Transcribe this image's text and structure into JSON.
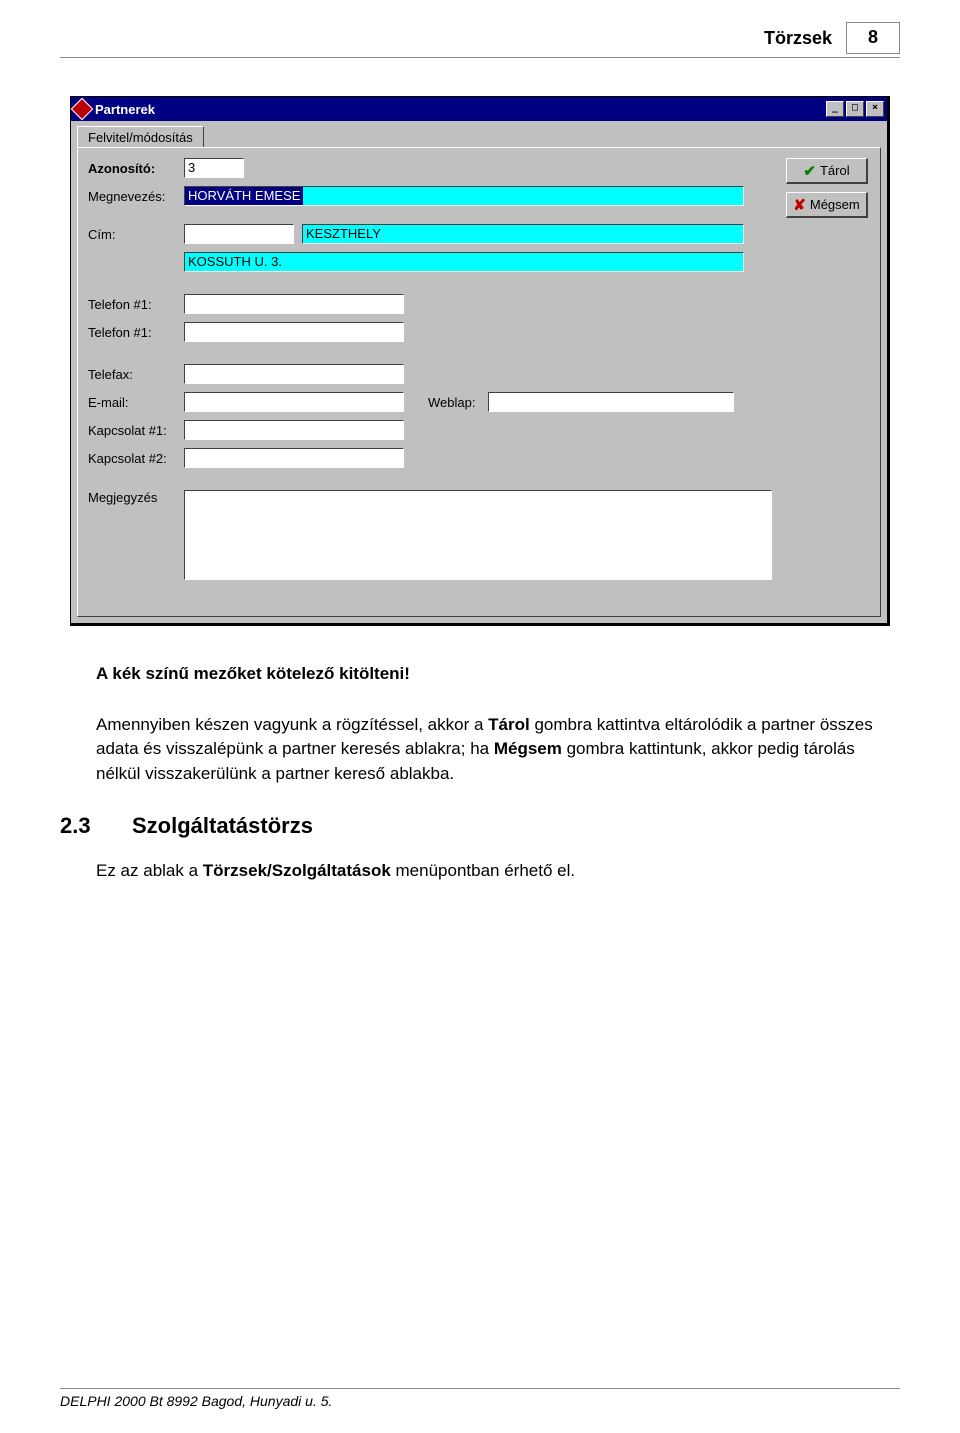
{
  "page": {
    "header_title": "Törzsek",
    "page_number": "8",
    "footer": "DELPHI 2000 Bt 8992 Bagod, Hunyadi u. 5."
  },
  "window": {
    "title": "Partnerek",
    "tab_label": "Felvitel/módosítás",
    "buttons": {
      "save": "Tárol",
      "cancel": "Mégsem"
    },
    "fields": {
      "id_label": "Azonosító:",
      "id_value": "3",
      "name_label": "Megnevezés:",
      "name_value": "HORVÁTH EMESE",
      "addr_label": "Cím:",
      "addr_zip": "",
      "addr_city": "KESZTHELY",
      "addr_street": "KOSSUTH U. 3.",
      "tel1_label": "Telefon #1:",
      "tel1_value": "",
      "tel2_label": "Telefon #1:",
      "tel2_value": "",
      "fax_label": "Telefax:",
      "fax_value": "",
      "email_label": "E-mail:",
      "email_value": "",
      "web_label": "Weblap:",
      "web_value": "",
      "contact1_label": "Kapcsolat #1:",
      "contact1_value": "",
      "contact2_label": "Kapcsolat #2:",
      "contact2_value": "",
      "note_label": "Megjegyzés"
    }
  },
  "text": {
    "p1": "A kék színű mezőket kötelező kitölteni!",
    "p2_a": "Amennyiben készen vagyunk a rögzítéssel, akkor a ",
    "p2_b1": "Tárol",
    "p2_c": " gombra kattintva eltárolódik a partner összes adata és visszalépünk a partner keresés ablakra; ha ",
    "p2_b2": "Mégsem",
    "p2_d": " gombra kattintunk, akkor pedig tárolás nélkül visszakerülünk a partner kereső ablakba.",
    "sec_num": "2.3",
    "sec_title": "Szolgáltatástörzs",
    "p3_a": "Ez az ablak a ",
    "p3_b": "Törzsek/Szolgáltatások",
    "p3_c": " menüpontban érhető el."
  }
}
